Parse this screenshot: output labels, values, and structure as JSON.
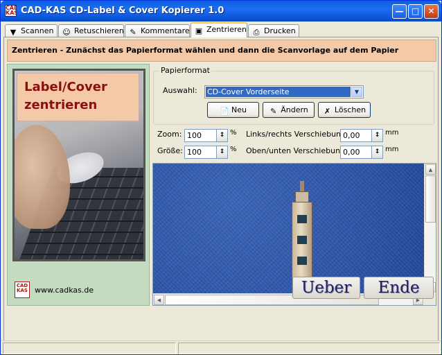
{
  "window": {
    "title": "CAD-KAS CD-Label & Cover Kopierer 1.0",
    "icon_name": "cadkas-app-icon",
    "controls": [
      "minimize",
      "maximize",
      "close"
    ]
  },
  "tabs": [
    {
      "label": "Scannen",
      "icon": "scanner-icon",
      "active": false
    },
    {
      "label": "Retuschieren",
      "icon": "retouch-face-icon",
      "active": false
    },
    {
      "label": "Kommentare",
      "icon": "comment-icon",
      "active": false
    },
    {
      "label": "Zentrieren",
      "icon": "center-icon",
      "active": true
    },
    {
      "label": "Drucken",
      "icon": "printer-icon",
      "active": false
    }
  ],
  "banner": {
    "text": "Zentrieren - Zunächst das Papierformat wählen und dann die Scanvorlage auf dem Papier zentrieren"
  },
  "left_panel": {
    "title_line1": "Label/Cover",
    "title_line2": "zentrieren"
  },
  "papierformat": {
    "group_label": "Papierformat",
    "select_label": "Auswahl:",
    "selected_value": "CD-Cover Vorderseite",
    "buttons": {
      "new": "Neu",
      "edit": "Ändern",
      "delete": "Löschen"
    }
  },
  "transform": {
    "zoom_label": "Zoom:",
    "zoom_value": "100",
    "zoom_unit": "%",
    "size_label": "Größe:",
    "size_value": "100",
    "size_unit": "%",
    "lr_label": "Links/rechts Verschiebung:",
    "lr_value": "0,00",
    "lr_unit": "mm",
    "ud_label": "Oben/unten Verschiebung:",
    "ud_value": "0,00",
    "ud_unit": "mm"
  },
  "footer": {
    "url": "www.cadkas.de",
    "logo_text": "CAD KAS",
    "ueber_label": "Ueber",
    "ende_label": "Ende"
  },
  "colors": {
    "banner_bg": "#f3c9a8",
    "panel_bg": "#c3dbbf",
    "title_red": "#8a0f0f",
    "selection_blue": "#316ac5"
  }
}
